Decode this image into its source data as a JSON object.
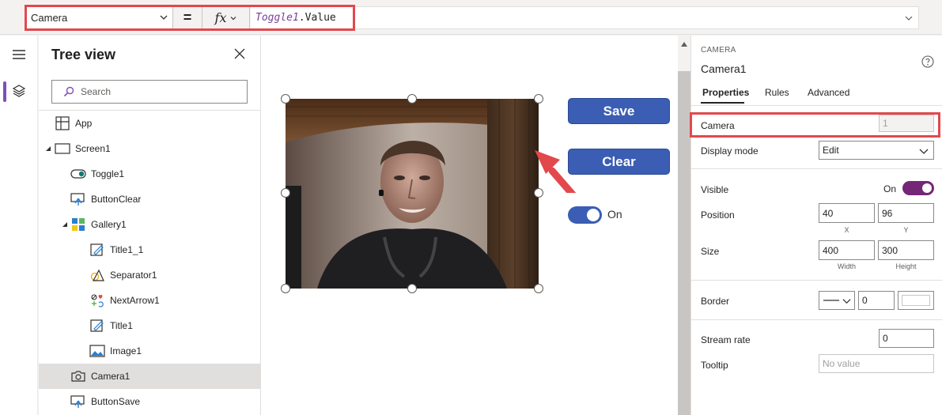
{
  "formula_bar": {
    "property": "Camera",
    "equals": "=",
    "fx": "fx",
    "formula_ident": "Toggle1",
    "formula_rest": ".Value"
  },
  "tree": {
    "title": "Tree view",
    "search_placeholder": "Search",
    "items": [
      {
        "label": "App",
        "icon": "app-icon"
      },
      {
        "label": "Screen1",
        "icon": "screen-icon"
      },
      {
        "label": "Toggle1",
        "icon": "toggle-icon"
      },
      {
        "label": "ButtonClear",
        "icon": "button-icon"
      },
      {
        "label": "Gallery1",
        "icon": "gallery-icon"
      },
      {
        "label": "Title1_1",
        "icon": "label-icon"
      },
      {
        "label": "Separator1",
        "icon": "shape-icon"
      },
      {
        "label": "NextArrow1",
        "icon": "icon-control-icon"
      },
      {
        "label": "Title1",
        "icon": "label-icon"
      },
      {
        "label": "Image1",
        "icon": "image-icon"
      },
      {
        "label": "Camera1",
        "icon": "camera-icon"
      },
      {
        "label": "ButtonSave",
        "icon": "button-icon"
      }
    ],
    "selected": "Camera1"
  },
  "canvas": {
    "save_label": "Save",
    "clear_label": "Clear",
    "toggle_label": "On",
    "toggle_on": true
  },
  "properties": {
    "control_type": "CAMERA",
    "control_name": "Camera1",
    "tabs": [
      "Properties",
      "Rules",
      "Advanced"
    ],
    "active_tab": "Properties",
    "camera_label": "Camera",
    "camera_value": "1",
    "display_mode_label": "Display mode",
    "display_mode_value": "Edit",
    "visible_label": "Visible",
    "visible_value": "On",
    "position_label": "Position",
    "position_x": "40",
    "position_y": "96",
    "x_caption": "X",
    "y_caption": "Y",
    "size_label": "Size",
    "size_width": "400",
    "size_height": "300",
    "width_caption": "Width",
    "height_caption": "Height",
    "border_label": "Border",
    "border_width": "0",
    "stream_rate_label": "Stream rate",
    "stream_rate_value": "0",
    "tooltip_label": "Tooltip",
    "tooltip_placeholder": "No value"
  },
  "colors": {
    "accent_purple": "#742774",
    "button_blue": "#3b5eb4",
    "highlight_red": "#e2484c"
  }
}
